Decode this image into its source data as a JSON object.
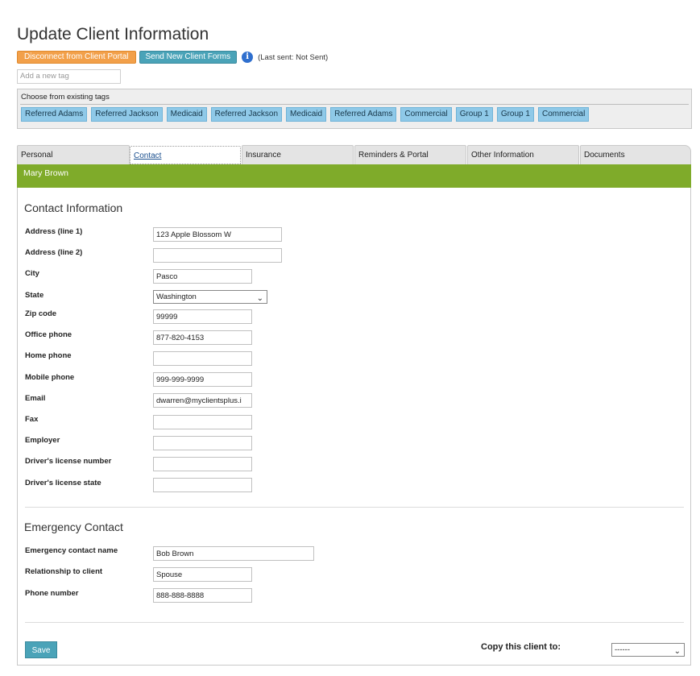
{
  "page": {
    "title": "Update Client Information"
  },
  "top_actions": {
    "disconnect_label": "Disconnect from Client Portal",
    "send_forms_label": "Send New Client Forms",
    "info_icon": "i",
    "last_sent": "(Last sent: Not Sent)"
  },
  "tag_input": {
    "placeholder": "Add a new tag"
  },
  "existing_tags": {
    "label": "Choose from existing tags",
    "tags": [
      "Referred Adams",
      "Referred Jackson",
      "Medicaid",
      "Referred Jackson",
      "Medicaid",
      "Referred Adams",
      "Commercial",
      "Group 1",
      "Group 1",
      "Commercial"
    ]
  },
  "tabs": [
    "Personal",
    "Contact",
    "Insurance",
    "Reminders & Portal",
    "Other Information",
    "Documents"
  ],
  "active_tab": "Contact",
  "client": {
    "name": "Mary Brown"
  },
  "contact": {
    "section_title": "Contact Information",
    "fields": [
      {
        "label": "Address (line 1)",
        "value": "123 Apple Blossom W"
      },
      {
        "label": "Address (line 2)",
        "value": ""
      },
      {
        "label": "City",
        "value": "Pasco"
      },
      {
        "label": "State",
        "value": "Washington"
      },
      {
        "label": "Zip code",
        "value": "99999"
      },
      {
        "label": "Office phone",
        "value": "877-820-4153"
      },
      {
        "label": "Home phone",
        "value": ""
      },
      {
        "label": "Mobile phone",
        "value": "999-999-9999"
      },
      {
        "label": "Email",
        "value": "dwarren@myclientsplus.i"
      },
      {
        "label": "Fax",
        "value": ""
      },
      {
        "label": "Employer",
        "value": ""
      },
      {
        "label": "Driver's license number",
        "value": ""
      },
      {
        "label": "Driver's license state",
        "value": ""
      }
    ]
  },
  "emergency": {
    "section_title": "Emergency Contact",
    "fields": [
      {
        "label": "Emergency contact name",
        "value": "Bob Brown"
      },
      {
        "label": "Relationship to client",
        "value": "Spouse"
      },
      {
        "label": "Phone number",
        "value": "888-888-8888"
      }
    ]
  },
  "footer": {
    "save_label": "Save",
    "copy_label": "Copy this client to:",
    "copy_select_value": "------"
  },
  "colors": {
    "accent_green": "#7fab2a",
    "teal": "#4aa3b8",
    "orange": "#f2a04a",
    "tag_blue": "#8fc9e8"
  },
  "icons": {
    "info": "info-icon",
    "dropdown": "chevron-down-icon"
  }
}
